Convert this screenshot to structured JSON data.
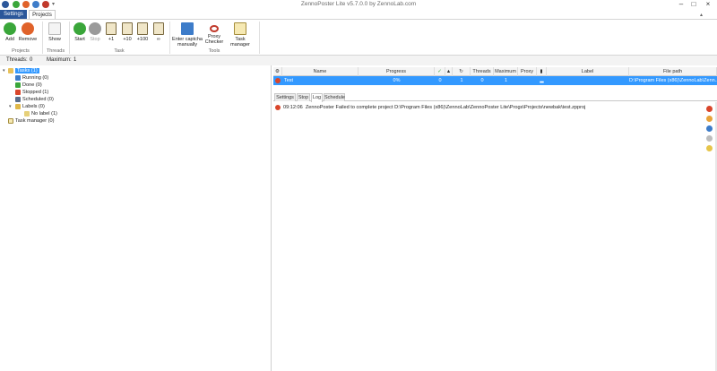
{
  "window": {
    "title": "ZennoPoster Lite v5.7.0.0 by ZennoLab.com"
  },
  "tabs": {
    "settings": "Settings",
    "projects": "Projects"
  },
  "ribbon": {
    "projects": {
      "add": "Add",
      "remove": "Remove",
      "group": "Projects"
    },
    "threads": {
      "show": "Show",
      "group": "Threads"
    },
    "task": {
      "start": "Start",
      "stop": "Stop",
      "plus1": "+1",
      "plus10": "+10",
      "plus100": "+100",
      "inf": "∞",
      "group": "Task"
    },
    "tools": {
      "captcha": "Enter captcha manually",
      "proxy": "Proxy Checker",
      "taskmgr": "Task manager",
      "group": "Tools"
    }
  },
  "status": {
    "threads_label": "Threads:",
    "threads_value": "0",
    "maximum_label": "Maximum:",
    "maximum_value": "1"
  },
  "tree": {
    "tasks": "Tasks (1)",
    "running": "Running (0)",
    "done": "Done (0)",
    "stopped": "Stopped (1)",
    "scheduled": "Scheduled (0)",
    "labels": "Labels (0)",
    "nolabel": "No label (1)",
    "taskmanager": "Task manager (0)"
  },
  "grid": {
    "headers": {
      "name": "Name",
      "progress": "Progress",
      "threads": "Threads",
      "maximum": "Maximum",
      "proxy": "Proxy",
      "label": "Label",
      "filepath": "File path"
    },
    "row": {
      "name": "Test",
      "progress": "0%",
      "success": "0",
      "fail": "1",
      "repeat": "0",
      "threads": "0",
      "maximum": "1",
      "proxy": "",
      "label": "",
      "filepath": "D:\\Program Files (x86)\\ZennoLab\\Zenn..."
    }
  },
  "subtabs": {
    "settings": "Settings",
    "stop": "Stop",
    "log": "Log",
    "schedule": "Schedule"
  },
  "log": {
    "time": "09:12:06",
    "message": "ZennoPoster Failed to complete project D:\\Program Files (x86)\\ZennoLab\\ZennoPoster Lite\\Progs\\Projects\\newbak\\test.zpproj"
  },
  "colors": {
    "accent": "#3399ff",
    "tab_active": "#2b579a",
    "error": "#d9462b",
    "success": "#3aa63a"
  }
}
